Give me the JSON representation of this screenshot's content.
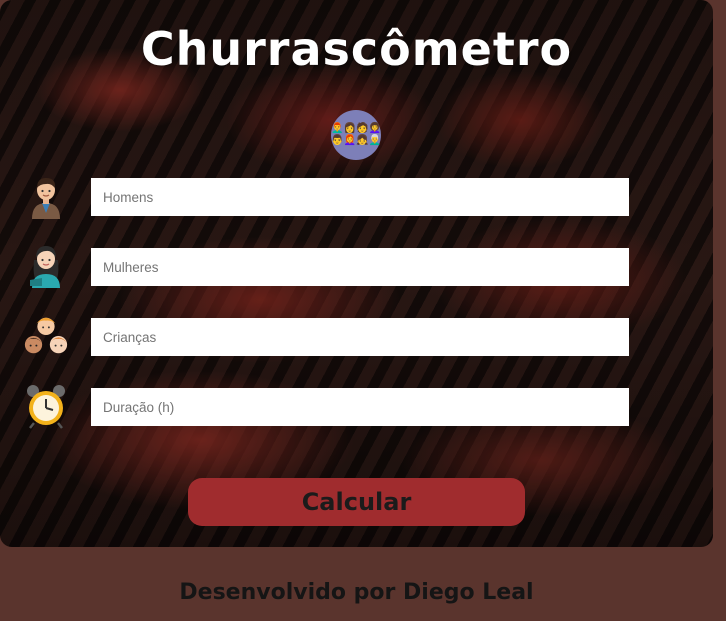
{
  "header": {
    "title": "Churrascômetro"
  },
  "icons": {
    "group": "group-of-people-icon",
    "men": "man-icon",
    "women": "woman-icon",
    "children": "children-icon",
    "duration": "alarm-clock-icon"
  },
  "form": {
    "men_placeholder": "Homens",
    "women_placeholder": "Mulheres",
    "children_placeholder": "Crianças",
    "duration_placeholder": "Duração (h)",
    "submit_label": "Calcular"
  },
  "footer": {
    "credit": "Desenvolvido por Diego Leal"
  },
  "colors": {
    "page_background": "#5a342d",
    "button": "#a02c2e",
    "title_text": "#ffffff"
  }
}
